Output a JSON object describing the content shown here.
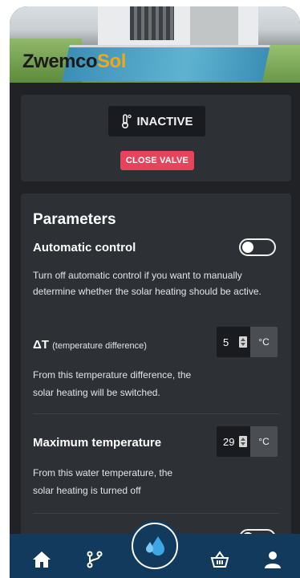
{
  "brand": {
    "part1": "Zwemco",
    "part2": "Sol",
    "accent": "#f0a818"
  },
  "status": {
    "label": "INACTIVE",
    "icon": "thermometer-icon"
  },
  "close_valve": {
    "label": "CLOSE VALVE",
    "color": "#e8435c"
  },
  "parameters": {
    "title": "Parameters",
    "automatic_control": {
      "title": "Automatic control",
      "enabled": false,
      "description": "Turn off automatic control if you want to manually determine whether the solar heating should be active."
    },
    "delta_t": {
      "symbol": "ΔT",
      "subtitle": "(temperature difference)",
      "value": "5",
      "unit": "°C",
      "description_line1": "From this temperature difference, the",
      "description_line2": "solar heating will be switched."
    },
    "max_temp": {
      "title": "Maximum temperature",
      "value": "29",
      "unit": "°C",
      "description_line1": "From this water temperature, the",
      "description_line2": "solar heating is turned off"
    }
  },
  "nav": {
    "items": [
      "home-icon",
      "branch-icon",
      "water-drop-icon",
      "basket-icon",
      "user-icon"
    ],
    "bg": "#123a5c"
  }
}
